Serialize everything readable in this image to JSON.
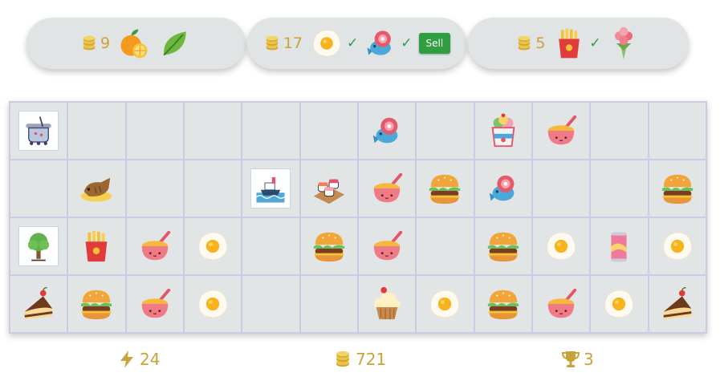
{
  "orders": [
    {
      "reward": "9",
      "items": [
        {
          "icon": "orange-icon",
          "done": false
        },
        {
          "icon": "leaf-icon",
          "done": false
        }
      ],
      "sell_label": ""
    },
    {
      "reward": "17",
      "items": [
        {
          "icon": "fried-egg-icon",
          "done": true
        },
        {
          "icon": "fish-icon",
          "done": true
        }
      ],
      "sell_label": "Sell"
    },
    {
      "reward": "5",
      "items": [
        {
          "icon": "fries-icon",
          "done": true
        },
        {
          "icon": "bouquet-icon",
          "done": false
        }
      ],
      "sell_label": ""
    }
  ],
  "board": [
    [
      "pot-generator-icon",
      "",
      "",
      "",
      "",
      "",
      "fish-icon",
      "",
      "ice-cream-icon",
      "rice-bowl-icon",
      "",
      ""
    ],
    [
      "",
      "taiyaki-icon",
      "",
      "",
      "ship-generator-icon",
      "sushi-icon",
      "rice-bowl-icon",
      "burger-icon",
      "fish-icon",
      "",
      "",
      "burger-icon"
    ],
    [
      "tree-generator-icon",
      "fries-icon",
      "rice-bowl-icon",
      "fried-egg-icon",
      "",
      "burger-icon",
      "rice-bowl-icon",
      "",
      "burger-icon",
      "fried-egg-icon",
      "soda-can-icon",
      "fried-egg-icon"
    ],
    [
      "cake-slice-icon",
      "burger-icon",
      "rice-bowl-icon",
      "fried-egg-icon",
      "",
      "",
      "cupcake-icon",
      "fried-egg-icon",
      "burger-icon",
      "rice-bowl-icon",
      "fried-egg-icon",
      "cake-slice-icon"
    ]
  ],
  "stats": {
    "energy": "24",
    "coins": "721",
    "trophies": "3"
  },
  "colors": {
    "panel": "#e1e4e5",
    "gold": "#c9a23a",
    "check": "#2f9a4a",
    "sell": "#2e9e3f"
  }
}
